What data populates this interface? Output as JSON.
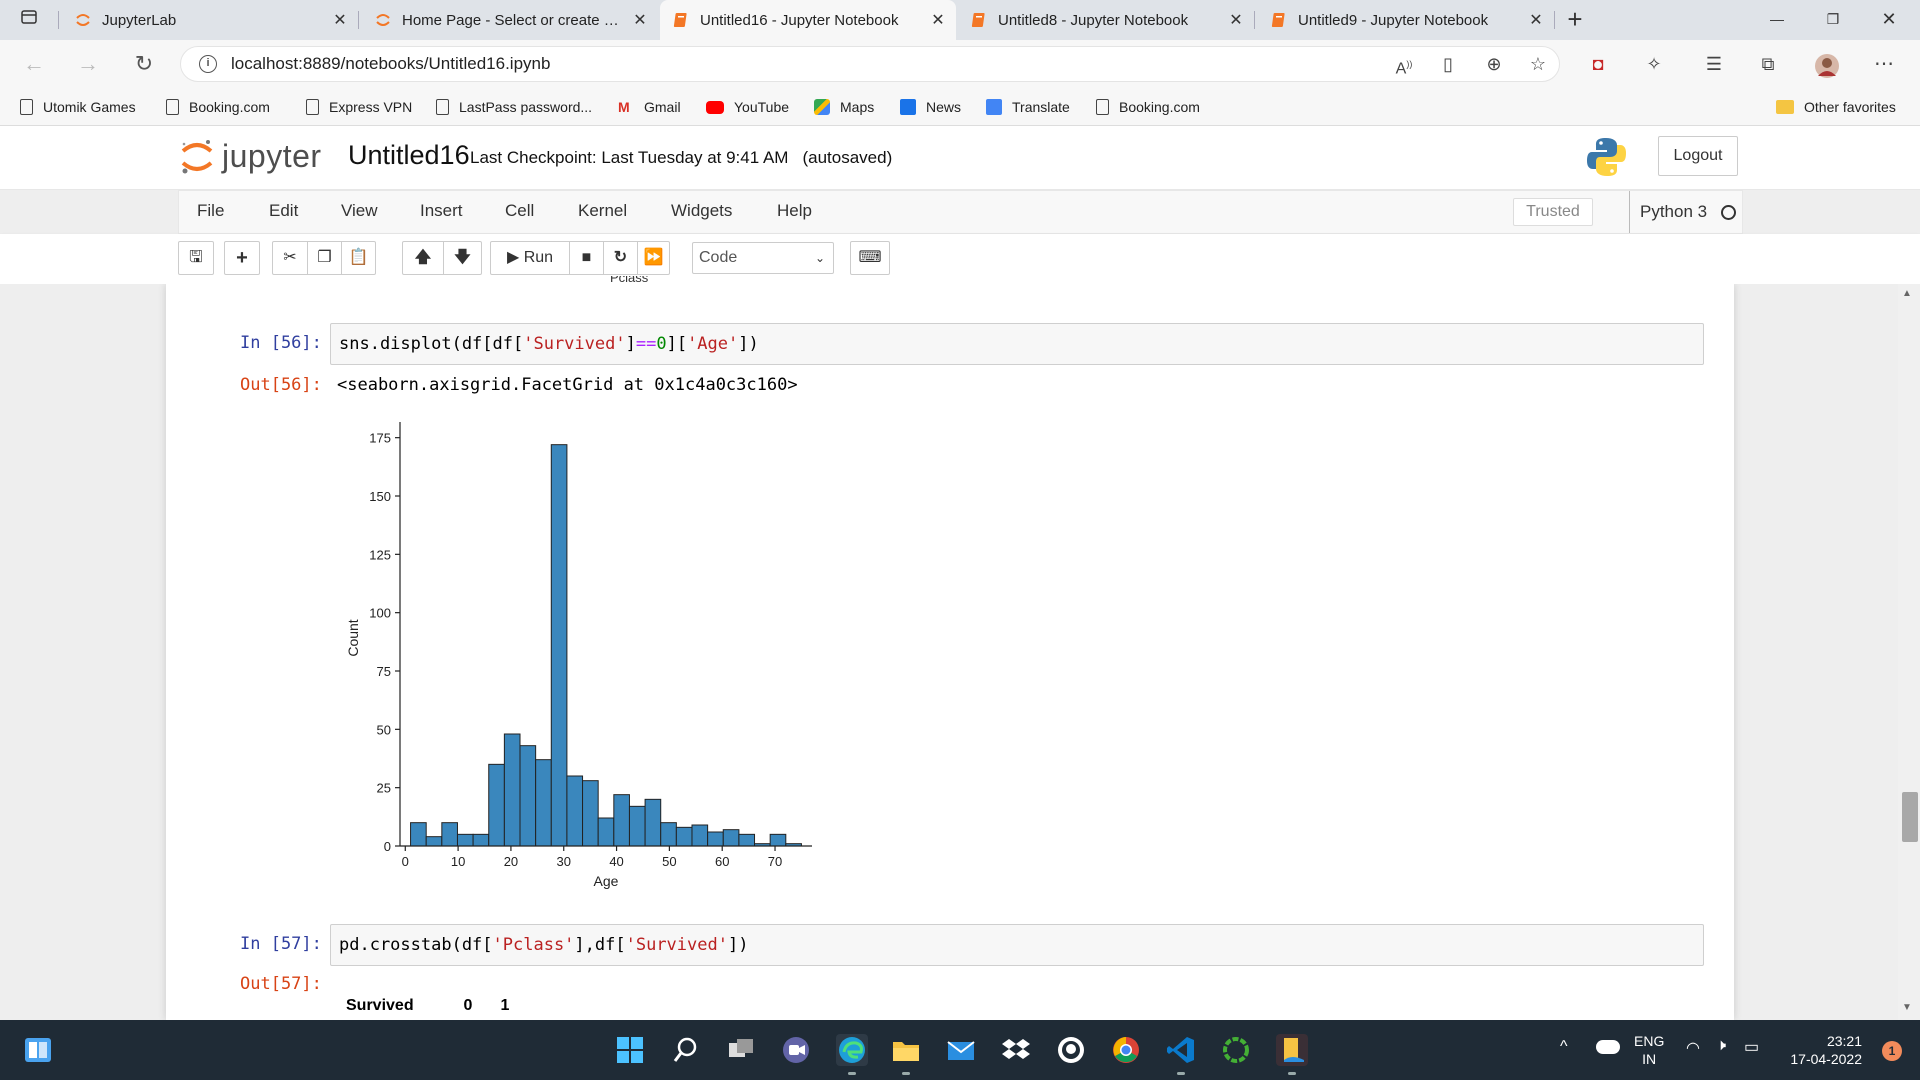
{
  "browser": {
    "tabs": [
      {
        "label": "JupyterLab",
        "icon": "jupyter-icon",
        "active": false
      },
      {
        "label": "Home Page - Select or create a n",
        "icon": "jupyter-icon",
        "active": false
      },
      {
        "label": "Untitled16 - Jupyter Notebook",
        "icon": "notebook-icon",
        "active": true
      },
      {
        "label": "Untitled8 - Jupyter Notebook",
        "icon": "notebook-icon",
        "active": false
      },
      {
        "label": "Untitled9 - Jupyter Notebook",
        "icon": "notebook-icon",
        "active": false
      }
    ],
    "url": "localhost:8889/notebooks/Untitled16.ipynb",
    "bookmarks": [
      {
        "label": "Utomik Games",
        "icon": "page-icon"
      },
      {
        "label": "Booking.com",
        "icon": "page-icon"
      },
      {
        "label": "Express VPN",
        "icon": "page-icon"
      },
      {
        "label": "LastPass password...",
        "icon": "page-icon"
      },
      {
        "label": "Gmail",
        "icon": "gmail-icon"
      },
      {
        "label": "YouTube",
        "icon": "youtube-icon"
      },
      {
        "label": "Maps",
        "icon": "maps-icon"
      },
      {
        "label": "News",
        "icon": "news-icon"
      },
      {
        "label": "Translate",
        "icon": "translate-icon"
      },
      {
        "label": "Booking.com",
        "icon": "page-icon"
      }
    ],
    "other_favorites": "Other favorites"
  },
  "jupyter": {
    "logo_text": "jupyter",
    "notebook_name": "Untitled16",
    "checkpoint": "Last Checkpoint: Last Tuesday at 9:41 AM",
    "autosaved": "(autosaved)",
    "logout": "Logout",
    "menus": [
      "File",
      "Edit",
      "View",
      "Insert",
      "Cell",
      "Kernel",
      "Widgets",
      "Help"
    ],
    "trusted": "Trusted",
    "kernel_name": "Python 3",
    "toolbar": {
      "run_label": "Run",
      "cell_type": "Code"
    }
  },
  "cells": {
    "prev_label_fragment": "Pclass",
    "cell56": {
      "in_prompt": "In [56]:",
      "code_parts": [
        "sns.displot(df[df[",
        "'Survived'",
        "]",
        "==",
        "0",
        "][",
        "'Age'",
        "])"
      ],
      "out_prompt": "Out[56]:",
      "output_text": "<seaborn.axisgrid.FacetGrid at 0x1c4a0c3c160>"
    },
    "cell57": {
      "in_prompt": "In [57]:",
      "code_parts": [
        "pd.crosstab(df[",
        "'Pclass'",
        "],df[",
        "'Survived'",
        "])"
      ],
      "out_prompt": "Out[57]:",
      "table_header": [
        "Survived",
        "0",
        "1"
      ]
    }
  },
  "chart_data": {
    "type": "bar",
    "title": "",
    "xlabel": "Age",
    "ylabel": "Count",
    "bar_color": "#3a87bd",
    "xlim": [
      -1,
      77
    ],
    "ylim": [
      0,
      180
    ],
    "xticks": [
      0,
      10,
      20,
      30,
      40,
      50,
      60,
      70
    ],
    "yticks": [
      0,
      25,
      50,
      75,
      100,
      125,
      150,
      175
    ],
    "bin_width": 2.96,
    "bin_start": 1,
    "values": [
      10,
      4,
      10,
      5,
      5,
      35,
      48,
      43,
      37,
      172,
      30,
      28,
      12,
      22,
      17,
      20,
      10,
      8,
      9,
      6,
      7,
      5,
      1,
      5,
      1
    ]
  },
  "taskbar": {
    "icons": [
      "windows-start-icon",
      "search-icon",
      "task-view-icon",
      "teams-icon",
      "edge-icon",
      "file-explorer-icon",
      "mail-icon",
      "dropbox-icon",
      "github-icon",
      "chrome-icon",
      "vscode-icon",
      "anaconda-icon",
      "jupyter-files-icon"
    ],
    "lang": "ENG",
    "region": "IN",
    "time": "23:21",
    "date": "17-04-2022",
    "notification_count": "1"
  }
}
